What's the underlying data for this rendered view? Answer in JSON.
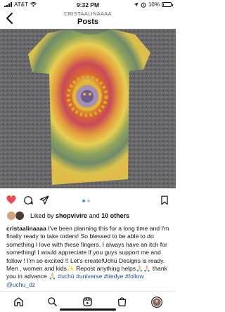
{
  "status_bar": {
    "carrier": "AT&T",
    "time": "9:32 PM",
    "battery": "10%",
    "battery_level": 0.1
  },
  "header": {
    "username": "CRISTAALINAAAA",
    "title": "Posts"
  },
  "post": {
    "image_description_icon": "tie-dye-shirt-photo",
    "carousel_dots": 2,
    "carousel_active": 0
  },
  "likes": {
    "prefix": "Liked by ",
    "user": "shopvivire",
    "connector": " and ",
    "others": "10 others"
  },
  "caption": {
    "username": "cristaalinaaaa",
    "text": " I've been planning this for a long time and I'm finally ready to take orders! So blessed to be able to do something I love with these fingers. I always have an itch for something! I would appreciate if you guys support me and follow ! I'm so excited !! Let's create!Uchū Designs is ready. Men , women and kids✨ Repost anything helps🙏🏻🙏🏻 thank you in advance 🙏🏻 ",
    "hashtags": "#uchū #universe #tiedye  #follow",
    "mention": "@uchu_dz"
  },
  "colors": {
    "heart": "#ed4956",
    "link": "#1a4f8b",
    "dot_active": "#3897f0"
  }
}
